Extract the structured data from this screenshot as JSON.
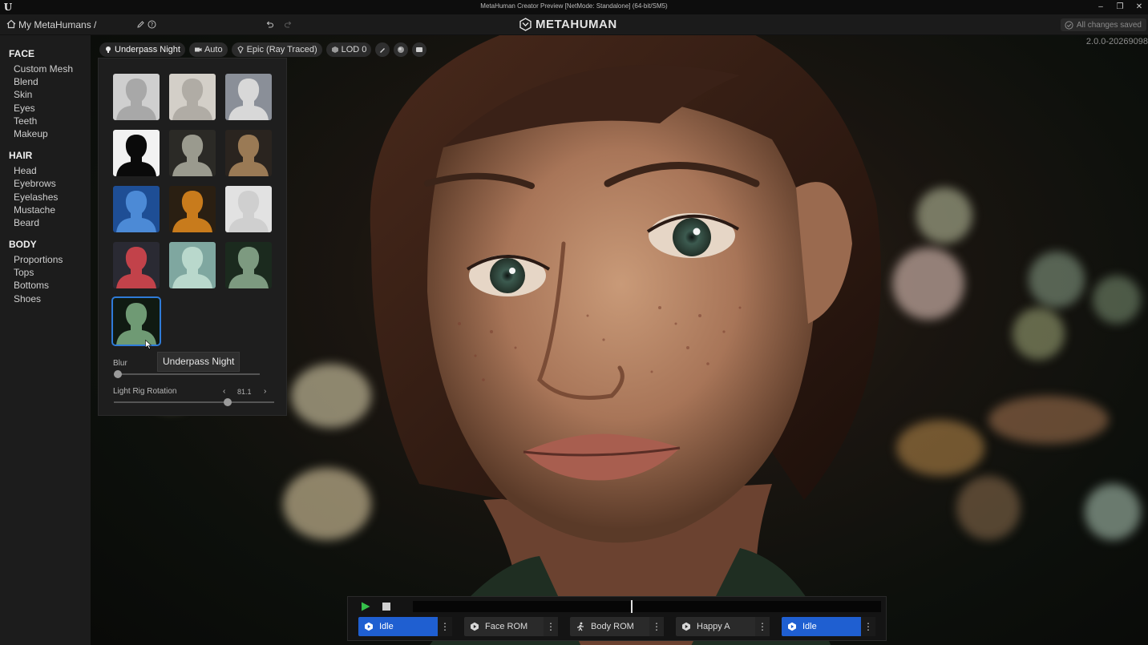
{
  "window": {
    "title": "MetaHuman Creator Preview [NetMode: Standalone]  (64-bit/SM5)",
    "controls": [
      "–",
      "❐",
      "✕"
    ]
  },
  "topbar": {
    "breadcrumb": "My MetaHumans /",
    "logo_text": "METAHUMAN",
    "save_status": "All changes saved"
  },
  "sidebar": {
    "sections": [
      {
        "title": "FACE",
        "items": [
          "Custom Mesh",
          "Blend",
          "Skin",
          "Eyes",
          "Teeth",
          "Makeup"
        ]
      },
      {
        "title": "HAIR",
        "items": [
          "Head",
          "Eyebrows",
          "Eyelashes",
          "Mustache",
          "Beard"
        ]
      },
      {
        "title": "BODY",
        "items": [
          "Proportions",
          "Tops",
          "Bottoms",
          "Shoes"
        ]
      }
    ]
  },
  "viewport": {
    "version": "2.0.0-20269098",
    "toolbar": {
      "light_rig": "Underpass Night",
      "camera": "Auto",
      "quality": "Epic (Ray Traced)",
      "lod": "LOD 0"
    }
  },
  "light_panel": {
    "selected_tooltip": "Underpass Night",
    "blur_label": "Blur",
    "blur_value": 0.0,
    "rotation_label": "Light Rig Rotation",
    "rotation_value": "81.1",
    "rotation_fraction": 0.71,
    "presets": [
      {
        "bg": "#cfcfcf",
        "head": "#a8a8a8"
      },
      {
        "bg": "#d3cfc8",
        "head": "#b0aca5"
      },
      {
        "bg": "#8a8f98",
        "head": "#d8d8d8"
      },
      {
        "bg": "#f2f2f2",
        "head": "#0a0a0a"
      },
      {
        "bg": "#2b2a26",
        "head": "#9a9a8e"
      },
      {
        "bg": "#2a241f",
        "head": "#9a7a55"
      },
      {
        "bg": "#1e4e95",
        "head": "#4c8ad6"
      },
      {
        "bg": "#2a1f12",
        "head": "#c87b1c"
      },
      {
        "bg": "#e2e2e2",
        "head": "#cfcfcf"
      },
      {
        "bg": "#2a2a33",
        "head": "#c2424a"
      },
      {
        "bg": "#7fa7a0",
        "head": "#b9d8cc"
      },
      {
        "bg": "#1b2a1e",
        "head": "#7d9a80"
      },
      {
        "bg": "#101a12",
        "head": "#6f9a74"
      }
    ]
  },
  "animation": {
    "chips": [
      {
        "label": "Idle",
        "active": true,
        "icon": "play-circle-icon"
      },
      {
        "label": "Face ROM",
        "active": false,
        "icon": "play-circle-icon"
      },
      {
        "label": "Body ROM",
        "active": false,
        "icon": "running-figure-icon"
      },
      {
        "label": "Happy A",
        "active": false,
        "icon": "play-circle-icon"
      },
      {
        "label": "Idle",
        "active": true,
        "icon": "play-circle-icon"
      }
    ],
    "menu_glyph": "⋮",
    "playhead_fraction": 0.465
  },
  "colors": {
    "accent": "#1f5fd1",
    "selection_outline": "#2f7bd8",
    "play_green": "#35c04a"
  }
}
